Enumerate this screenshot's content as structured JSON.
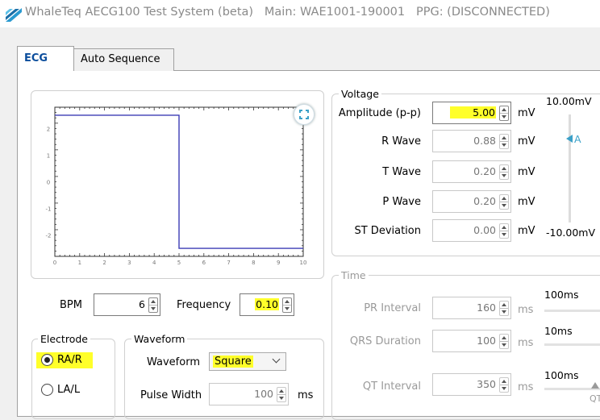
{
  "window": {
    "title": "WhaleTeq AECG100 Test System (beta)",
    "main_device": "Main: WAE1001-190001",
    "ppg_status": "PPG: (DISCONNECTED)"
  },
  "tabs": [
    {
      "label": "ECG",
      "active": true
    },
    {
      "label": "Auto Sequence",
      "active": false
    }
  ],
  "chart_data": {
    "type": "line",
    "x": [
      0,
      5.0,
      5.0,
      10
    ],
    "y": [
      2.5,
      2.5,
      -2.5,
      -2.5
    ],
    "xlim": [
      0,
      10
    ],
    "ylim": [
      -2.8,
      2.8
    ],
    "xticks": [
      "0",
      "1",
      "2",
      "3",
      "4",
      "5",
      "6",
      "7",
      "8",
      "9",
      "10"
    ],
    "yticks": [
      "2",
      "1",
      "0",
      "-1",
      "-2"
    ],
    "color": "#3b3bb5",
    "grid": false
  },
  "controls": {
    "bpm": {
      "label": "BPM",
      "value": "6"
    },
    "frequency": {
      "label": "Frequency",
      "value": "0.10"
    }
  },
  "electrode": {
    "legend": "Electrode",
    "options": [
      {
        "label": "RA/R",
        "selected": true
      },
      {
        "label": "LA/L",
        "selected": false
      }
    ]
  },
  "waveform": {
    "legend": "Waveform",
    "waveform_label": "Waveform",
    "waveform_value": "Square",
    "pulse_width_label": "Pulse Width",
    "pulse_width_value": "100",
    "pulse_width_unit": "ms"
  },
  "voltage": {
    "legend": "Voltage",
    "rows": [
      {
        "label": "Amplitude (p-p)",
        "value": "5.00",
        "unit": "mV"
      },
      {
        "label": "R Wave",
        "value": "0.88",
        "unit": "mV"
      },
      {
        "label": "T Wave",
        "value": "0.20",
        "unit": "mV"
      },
      {
        "label": "P Wave",
        "value": "0.20",
        "unit": "mV"
      },
      {
        "label": "ST Deviation",
        "value": "0.00",
        "unit": "mV"
      }
    ],
    "scale_top": "10.00mV",
    "scale_bottom": "-10.00mV",
    "marker_label": "A"
  },
  "time": {
    "legend": "Time",
    "rows": [
      {
        "label": "PR Interval",
        "value": "160",
        "unit": "ms",
        "scale": "100ms"
      },
      {
        "label": "QRS Duration",
        "value": "100",
        "unit": "ms",
        "scale": "10ms"
      },
      {
        "label": "QT Interval",
        "value": "350",
        "unit": "ms",
        "scale": "100ms"
      }
    ],
    "cut_label": "QT"
  },
  "colors": {
    "accent": "#3aa0c8",
    "highlight": "#ffff2a",
    "tab_active": "#0b4d9c",
    "wave": "#3b3bb5"
  }
}
